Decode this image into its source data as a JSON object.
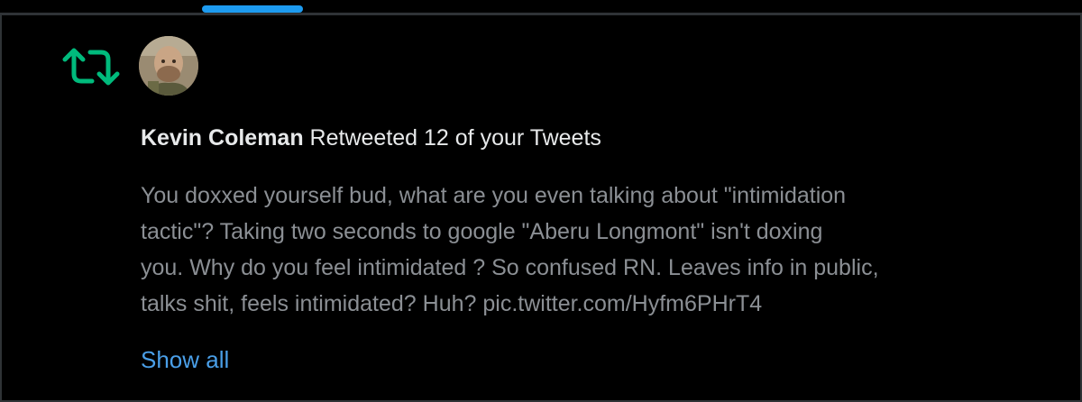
{
  "colors": {
    "accent": "#1d9bf0",
    "retweet_green": "#00ba7c",
    "link": "#4a9fe8",
    "muted_text": "#8b8f94",
    "primary_text": "#e7e9ea"
  },
  "notification": {
    "icon": "retweet-icon",
    "user_name": "Kevin Coleman",
    "action_text": " Retweeted 12 of your Tweets",
    "tweet_lines": [
      "You doxxed yourself bud, what are you even talking about \"intimidation",
      "tactic\"? Taking two seconds to google \"Aberu Longmont\" isn't doxing",
      "you. Why do you feel intimidated ? So confused RN. Leaves info in public,",
      "talks shit, feels intimidated? Huh? pic.twitter.com/Hyfm6PHrT4"
    ],
    "show_all_label": "Show all"
  }
}
